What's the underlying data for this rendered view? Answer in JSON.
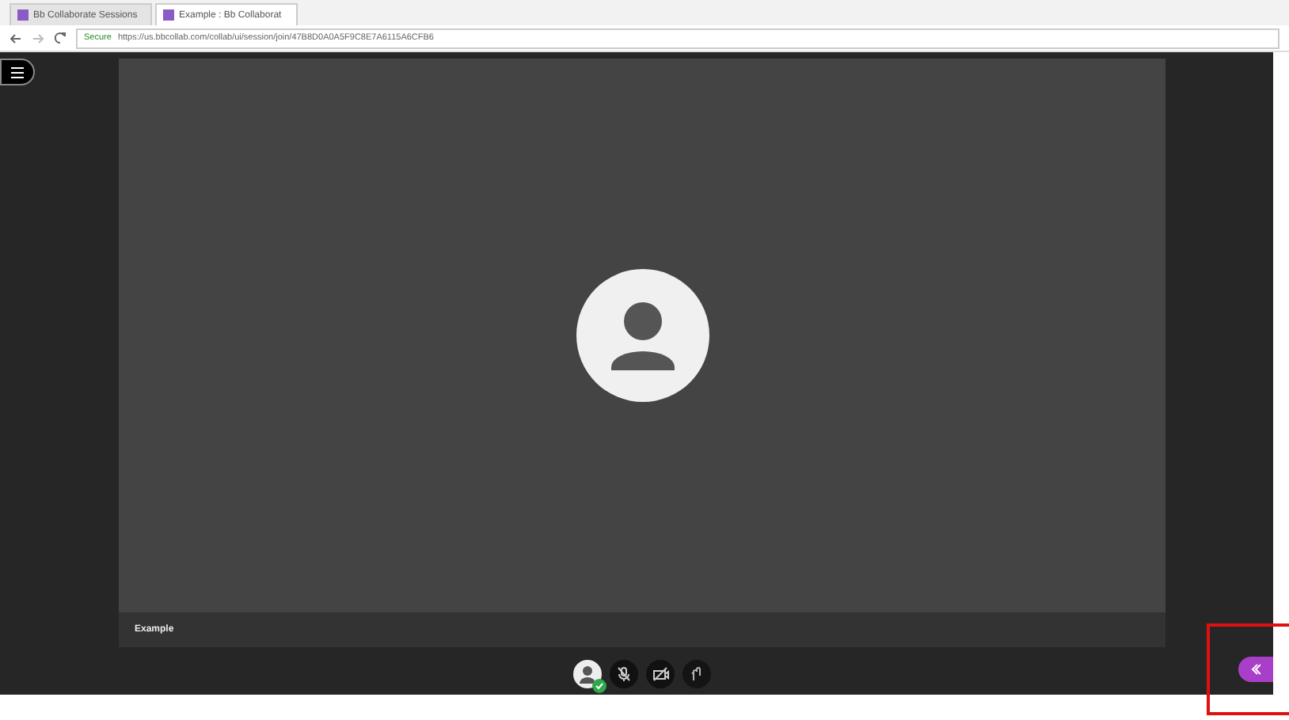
{
  "browser": {
    "tabs": [
      {
        "label": "Bb Collaborate Sessions",
        "selected": false
      },
      {
        "label": "Example : Bb Collaborat",
        "selected": true
      }
    ],
    "address": {
      "secure_label": "Secure",
      "url": "https://us.bbcollab.com/collab/ui/session/join/47B8D0A0A5F9C8E7A6115A6CFB6"
    }
  },
  "session": {
    "participant_name": "Example",
    "controls": [
      {
        "kind": "avatar",
        "status_ok": true
      },
      {
        "kind": "mic",
        "muted": true
      },
      {
        "kind": "camera",
        "muted": true
      },
      {
        "kind": "hand",
        "muted": false
      }
    ]
  },
  "annotation": {
    "kind": "highlight",
    "color": "#e01010"
  }
}
